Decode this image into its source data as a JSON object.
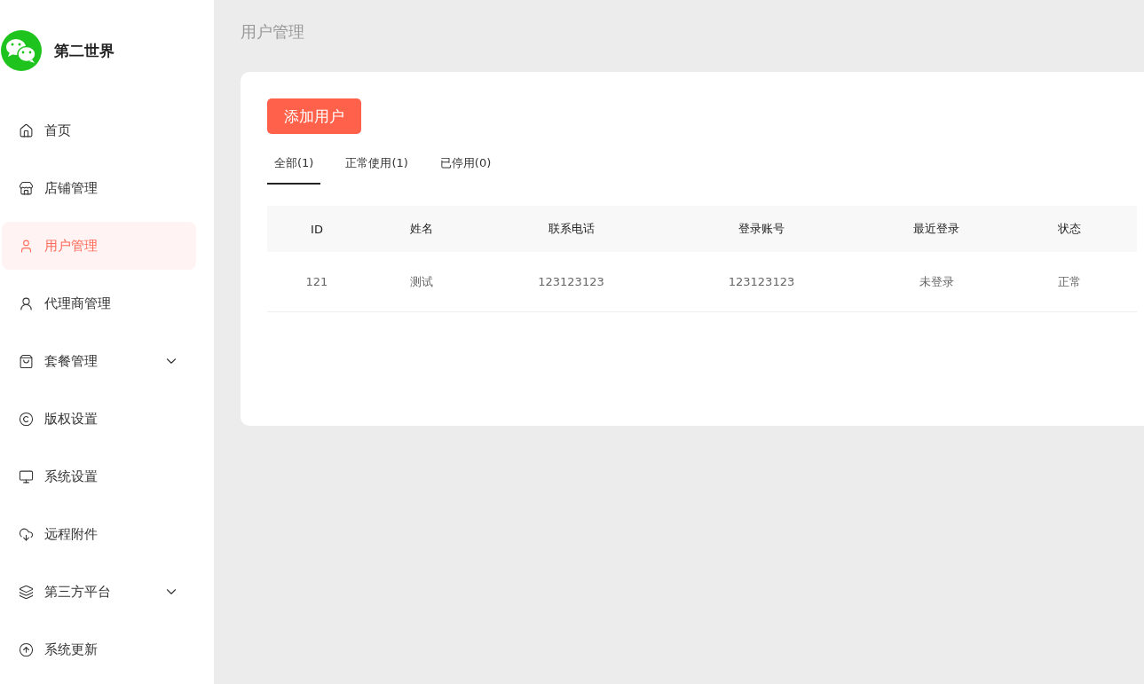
{
  "sidebar": {
    "brand": "第二世界",
    "items": [
      {
        "label": "首页",
        "selected": false,
        "expandable": false
      },
      {
        "label": "店铺管理",
        "selected": false,
        "expandable": false
      },
      {
        "label": "用户管理",
        "selected": true,
        "expandable": false
      },
      {
        "label": "代理商管理",
        "selected": false,
        "expandable": false
      },
      {
        "label": "套餐管理",
        "selected": false,
        "expandable": true
      },
      {
        "label": "版权设置",
        "selected": false,
        "expandable": false
      },
      {
        "label": "系统设置",
        "selected": false,
        "expandable": false
      },
      {
        "label": "远程附件",
        "selected": false,
        "expandable": false
      },
      {
        "label": "第三方平台",
        "selected": false,
        "expandable": true
      },
      {
        "label": "系统更新",
        "selected": false,
        "expandable": false
      }
    ]
  },
  "page_title": "用户管理",
  "add_button": "添加用户",
  "tabs": [
    {
      "label": "全部(1)",
      "selected": true
    },
    {
      "label": "正常使用(1)",
      "selected": false
    },
    {
      "label": "已停用(0)",
      "selected": false
    }
  ],
  "table": {
    "columns": [
      "ID",
      "姓名",
      "联系电话",
      "登录账号",
      "最近登录",
      "状态"
    ],
    "rows": [
      [
        "121",
        "测试",
        "123123123",
        "123123123",
        "未登录",
        "正常"
      ]
    ]
  }
}
